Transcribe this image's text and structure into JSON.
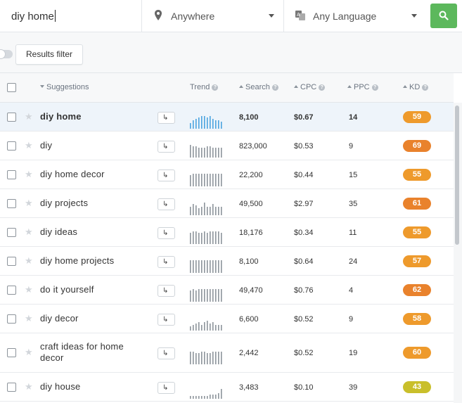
{
  "search": {
    "keyword": "diy home",
    "location": "Anywhere",
    "language": "Any Language"
  },
  "filter": {
    "label": "Results filter"
  },
  "columns": {
    "suggestions": "Suggestions",
    "trend": "Trend",
    "search": "Search",
    "cpc": "CPC",
    "ppc": "PPC",
    "kd": "KD"
  },
  "colors": {
    "search_button": "#5cb85c",
    "kd_orange": "#ee9a2c",
    "kd_deep_orange": "#e9822c",
    "kd_yellow": "#c9bf2b",
    "trend_active": "#4aa3df",
    "trend_normal": "#8d949b"
  },
  "icons": [
    "location-pin-icon",
    "translate-icon",
    "search-icon",
    "star-icon",
    "arrow-enter-icon",
    "question-icon"
  ],
  "rows": [
    {
      "keyword": "diy home",
      "search": "8,100",
      "cpc": "$0.67",
      "ppc": "14",
      "kd": "59",
      "kd_color": "#ee9a2c",
      "active": true,
      "trend": [
        4,
        6,
        7,
        8,
        9,
        9,
        8,
        9,
        7,
        6,
        6,
        5
      ]
    },
    {
      "keyword": "diy",
      "search": "823,000",
      "cpc": "$0.53",
      "ppc": "9",
      "kd": "69",
      "kd_color": "#e9822c",
      "active": false,
      "trend": [
        9,
        8,
        8,
        7,
        7,
        7,
        8,
        8,
        7,
        7,
        7,
        7
      ]
    },
    {
      "keyword": "diy home decor",
      "search": "22,200",
      "cpc": "$0.44",
      "ppc": "15",
      "kd": "55",
      "kd_color": "#ee9a2c",
      "active": false,
      "trend": [
        8,
        9,
        9,
        9,
        9,
        9,
        9,
        9,
        9,
        9,
        9,
        9
      ]
    },
    {
      "keyword": "diy projects",
      "search": "49,500",
      "cpc": "$2.97",
      "ppc": "35",
      "kd": "61",
      "kd_color": "#e9822c",
      "active": false,
      "trend": [
        6,
        8,
        7,
        5,
        6,
        9,
        6,
        6,
        8,
        6,
        6,
        6
      ]
    },
    {
      "keyword": "diy ideas",
      "search": "18,176",
      "cpc": "$0.34",
      "ppc": "11",
      "kd": "55",
      "kd_color": "#ee9a2c",
      "active": false,
      "trend": [
        8,
        9,
        9,
        8,
        8,
        9,
        8,
        9,
        9,
        9,
        9,
        8
      ]
    },
    {
      "keyword": "diy home projects",
      "search": "8,100",
      "cpc": "$0.64",
      "ppc": "24",
      "kd": "57",
      "kd_color": "#ee9a2c",
      "active": false,
      "trend": [
        9,
        9,
        9,
        9,
        9,
        9,
        9,
        9,
        9,
        9,
        9,
        9
      ]
    },
    {
      "keyword": "do it yourself",
      "search": "49,470",
      "cpc": "$0.76",
      "ppc": "4",
      "kd": "62",
      "kd_color": "#e9822c",
      "active": false,
      "trend": [
        8,
        9,
        8,
        9,
        9,
        9,
        9,
        9,
        9,
        9,
        9,
        9
      ]
    },
    {
      "keyword": "diy decor",
      "search": "6,600",
      "cpc": "$0.52",
      "ppc": "9",
      "kd": "58",
      "kd_color": "#ee9a2c",
      "active": false,
      "trend": [
        3,
        4,
        5,
        6,
        4,
        6,
        7,
        5,
        6,
        4,
        4,
        4
      ]
    },
    {
      "keyword": "craft ideas for home decor",
      "search": "2,442",
      "cpc": "$0.52",
      "ppc": "19",
      "kd": "60",
      "kd_color": "#ee9a2c",
      "active": false,
      "trend": [
        9,
        9,
        8,
        8,
        9,
        9,
        8,
        8,
        9,
        9,
        9,
        9
      ]
    },
    {
      "keyword": "diy house",
      "search": "3,483",
      "cpc": "$0.10",
      "ppc": "39",
      "kd": "43",
      "kd_color": "#c9bf2b",
      "active": false,
      "trend": [
        2,
        2,
        2,
        2,
        2,
        2,
        2,
        3,
        3,
        3,
        4,
        7
      ]
    }
  ]
}
